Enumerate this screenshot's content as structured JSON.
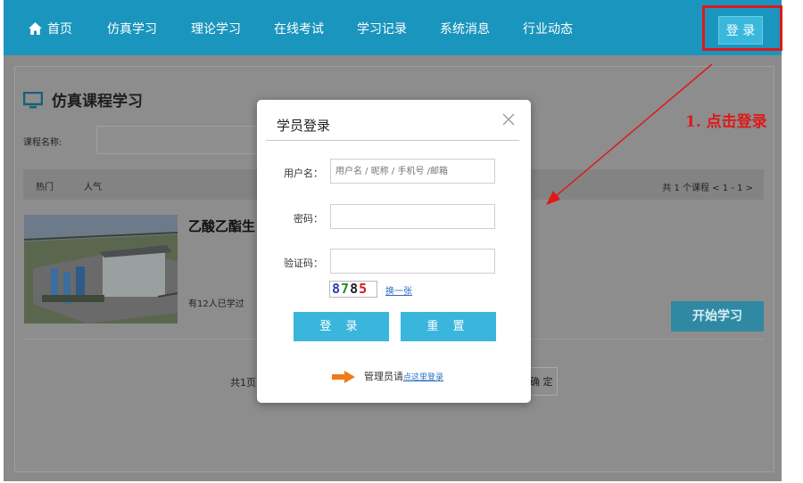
{
  "nav": {
    "items": [
      {
        "label": "首页",
        "icon": "home-icon"
      },
      {
        "label": "仿真学习"
      },
      {
        "label": "理论学习"
      },
      {
        "label": "在线考试"
      },
      {
        "label": "学习记录"
      },
      {
        "label": "系统消息"
      },
      {
        "label": "行业动态"
      }
    ],
    "login_label": "登 录"
  },
  "annotation": {
    "text": "1. 点击登录",
    "color": "#e01818"
  },
  "page": {
    "title": "仿真课程学习",
    "course_name_label": "课程名称:",
    "sort": {
      "hot": "热门",
      "popular": "人气",
      "summary": "共 1 个课程 < 1 - 1 >"
    },
    "course": {
      "title": "乙酸乙酯生",
      "learners": "有12人已学过",
      "start_label": "开始学习"
    },
    "pager": {
      "text": "共1页",
      "ok_label": "确 定"
    }
  },
  "modal": {
    "title": "学员登录",
    "username_label": "用户名：",
    "username_placeholder": "用户名 / 昵称 / 手机号 /邮箱",
    "password_label": "密码：",
    "captcha_label": "验证码：",
    "captcha_chars": [
      {
        "ch": "8",
        "color": "#2b3fb0"
      },
      {
        "ch": "7",
        "color": "#2a8a2a"
      },
      {
        "ch": "8",
        "color": "#222222"
      },
      {
        "ch": "5",
        "color": "#d02020"
      }
    ],
    "refresh_label": "换一张",
    "login_label": "登 录",
    "reset_label": "重 置",
    "admin_prefix": "管理员请",
    "admin_link": "点这里登录"
  },
  "colors": {
    "nav_bg": "#1a95bd",
    "accent": "#3ab6dc",
    "link": "#2b6fc4"
  }
}
